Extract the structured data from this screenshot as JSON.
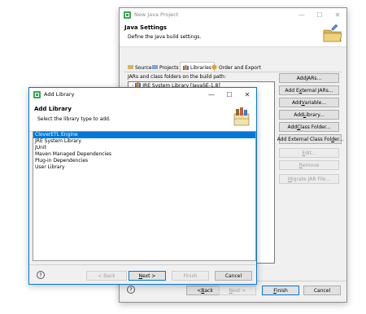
{
  "back_window": {
    "title": "New Java Project",
    "banner_title": "Java Settings",
    "banner_desc": "Define the Java build settings.",
    "tabs": [
      {
        "label": "Source"
      },
      {
        "label": "Projects"
      },
      {
        "label": "Libraries"
      },
      {
        "label": "Order and Export"
      }
    ],
    "build_path_label": "JARs and class folders on the build path:",
    "tree_item": "JRE System Library [JavaSE-1.8]",
    "side_buttons": {
      "add_jars": {
        "pre": "Add ",
        "u": "J",
        "post": "ARs..."
      },
      "add_external_jars": {
        "pre": "Add E",
        "u": "x",
        "post": "ternal JARs..."
      },
      "add_variable": {
        "pre": "Add ",
        "u": "V",
        "post": "ariable..."
      },
      "add_library": {
        "pre": "Add ",
        "u": "L",
        "post": "ibrary..."
      },
      "add_class_folder": {
        "pre": "Add ",
        "u": "C",
        "post": "lass Folder..."
      },
      "add_external_class_folder": {
        "pre": "Add External Class Fol",
        "u": "d",
        "post": "er..."
      },
      "edit": {
        "pre": "",
        "u": "E",
        "post": "dit..."
      },
      "remove": {
        "pre": "",
        "u": "R",
        "post": "emove"
      },
      "migrate": {
        "pre": "",
        "u": "M",
        "post": "igrate JAR File..."
      }
    },
    "footer": {
      "back": {
        "pre": "< ",
        "u": "B",
        "post": "ack"
      },
      "next": {
        "pre": "",
        "u": "N",
        "post": "ext >"
      },
      "finish": {
        "pre": "",
        "u": "F",
        "post": "inish"
      },
      "cancel": "Cancel"
    }
  },
  "front_window": {
    "title": "Add Library",
    "banner_title": "Add Library",
    "banner_desc": "Select the library type to add.",
    "library_types": [
      "CloverETL Engine",
      "JRE System Library",
      "JUnit",
      "Maven Managed Dependencies",
      "Plug-in Dependencies",
      "User Library"
    ],
    "selected_index": 0,
    "footer": {
      "back": "< Back",
      "next": {
        "pre": "",
        "u": "N",
        "post": "ext >"
      },
      "finish": "Finish",
      "cancel": "Cancel"
    }
  },
  "help_glyph": "?",
  "icons": [
    "eclipse-icon",
    "minimize-icon",
    "maximize-icon",
    "close-icon",
    "library-icon",
    "folder-banner-icon",
    "help-icon"
  ],
  "colors": {
    "selection": "#0078d7",
    "default_border": "#0078d7",
    "window_bg": "#f0f0f0",
    "disabled_text": "#a0a0a0"
  }
}
